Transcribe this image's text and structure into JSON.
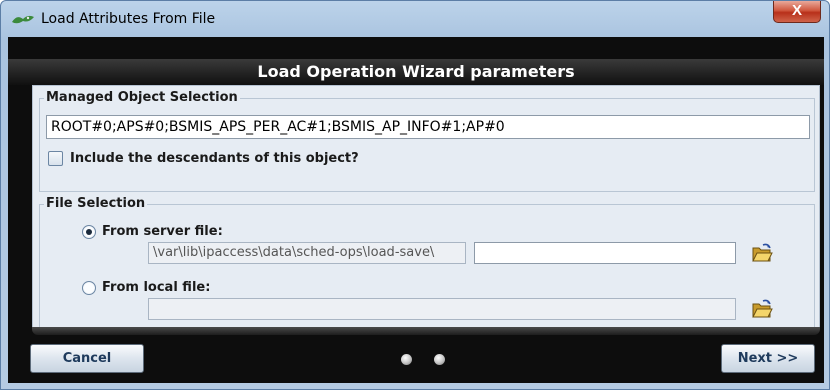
{
  "window": {
    "title": "Load Attributes From File",
    "close_label": "X"
  },
  "header": {
    "title": "Load Operation Wizard parameters"
  },
  "managed_object": {
    "legend": "Managed Object Selection",
    "value": "ROOT#0;APS#0;BSMIS_APS_PER_AC#1;BSMIS_AP_INFO#1;AP#0",
    "include_descendants_label": "Include the descendants of this object?",
    "include_descendants_checked": false
  },
  "file_selection": {
    "legend": "File Selection",
    "server_option_label": "From server file:",
    "server_option_selected": true,
    "server_path": "\\var\\lib\\ipaccess\\data\\sched-ops\\load-save\\",
    "server_filename": "",
    "local_option_label": "From local file:",
    "local_option_selected": false,
    "local_filename": ""
  },
  "footer": {
    "cancel_label": "Cancel",
    "next_label": "Next >>",
    "page_count": 2
  },
  "colors": {
    "header_bg": "#101010",
    "panel_bg": "#e6ecf3",
    "button_text": "#1e3a5c"
  }
}
